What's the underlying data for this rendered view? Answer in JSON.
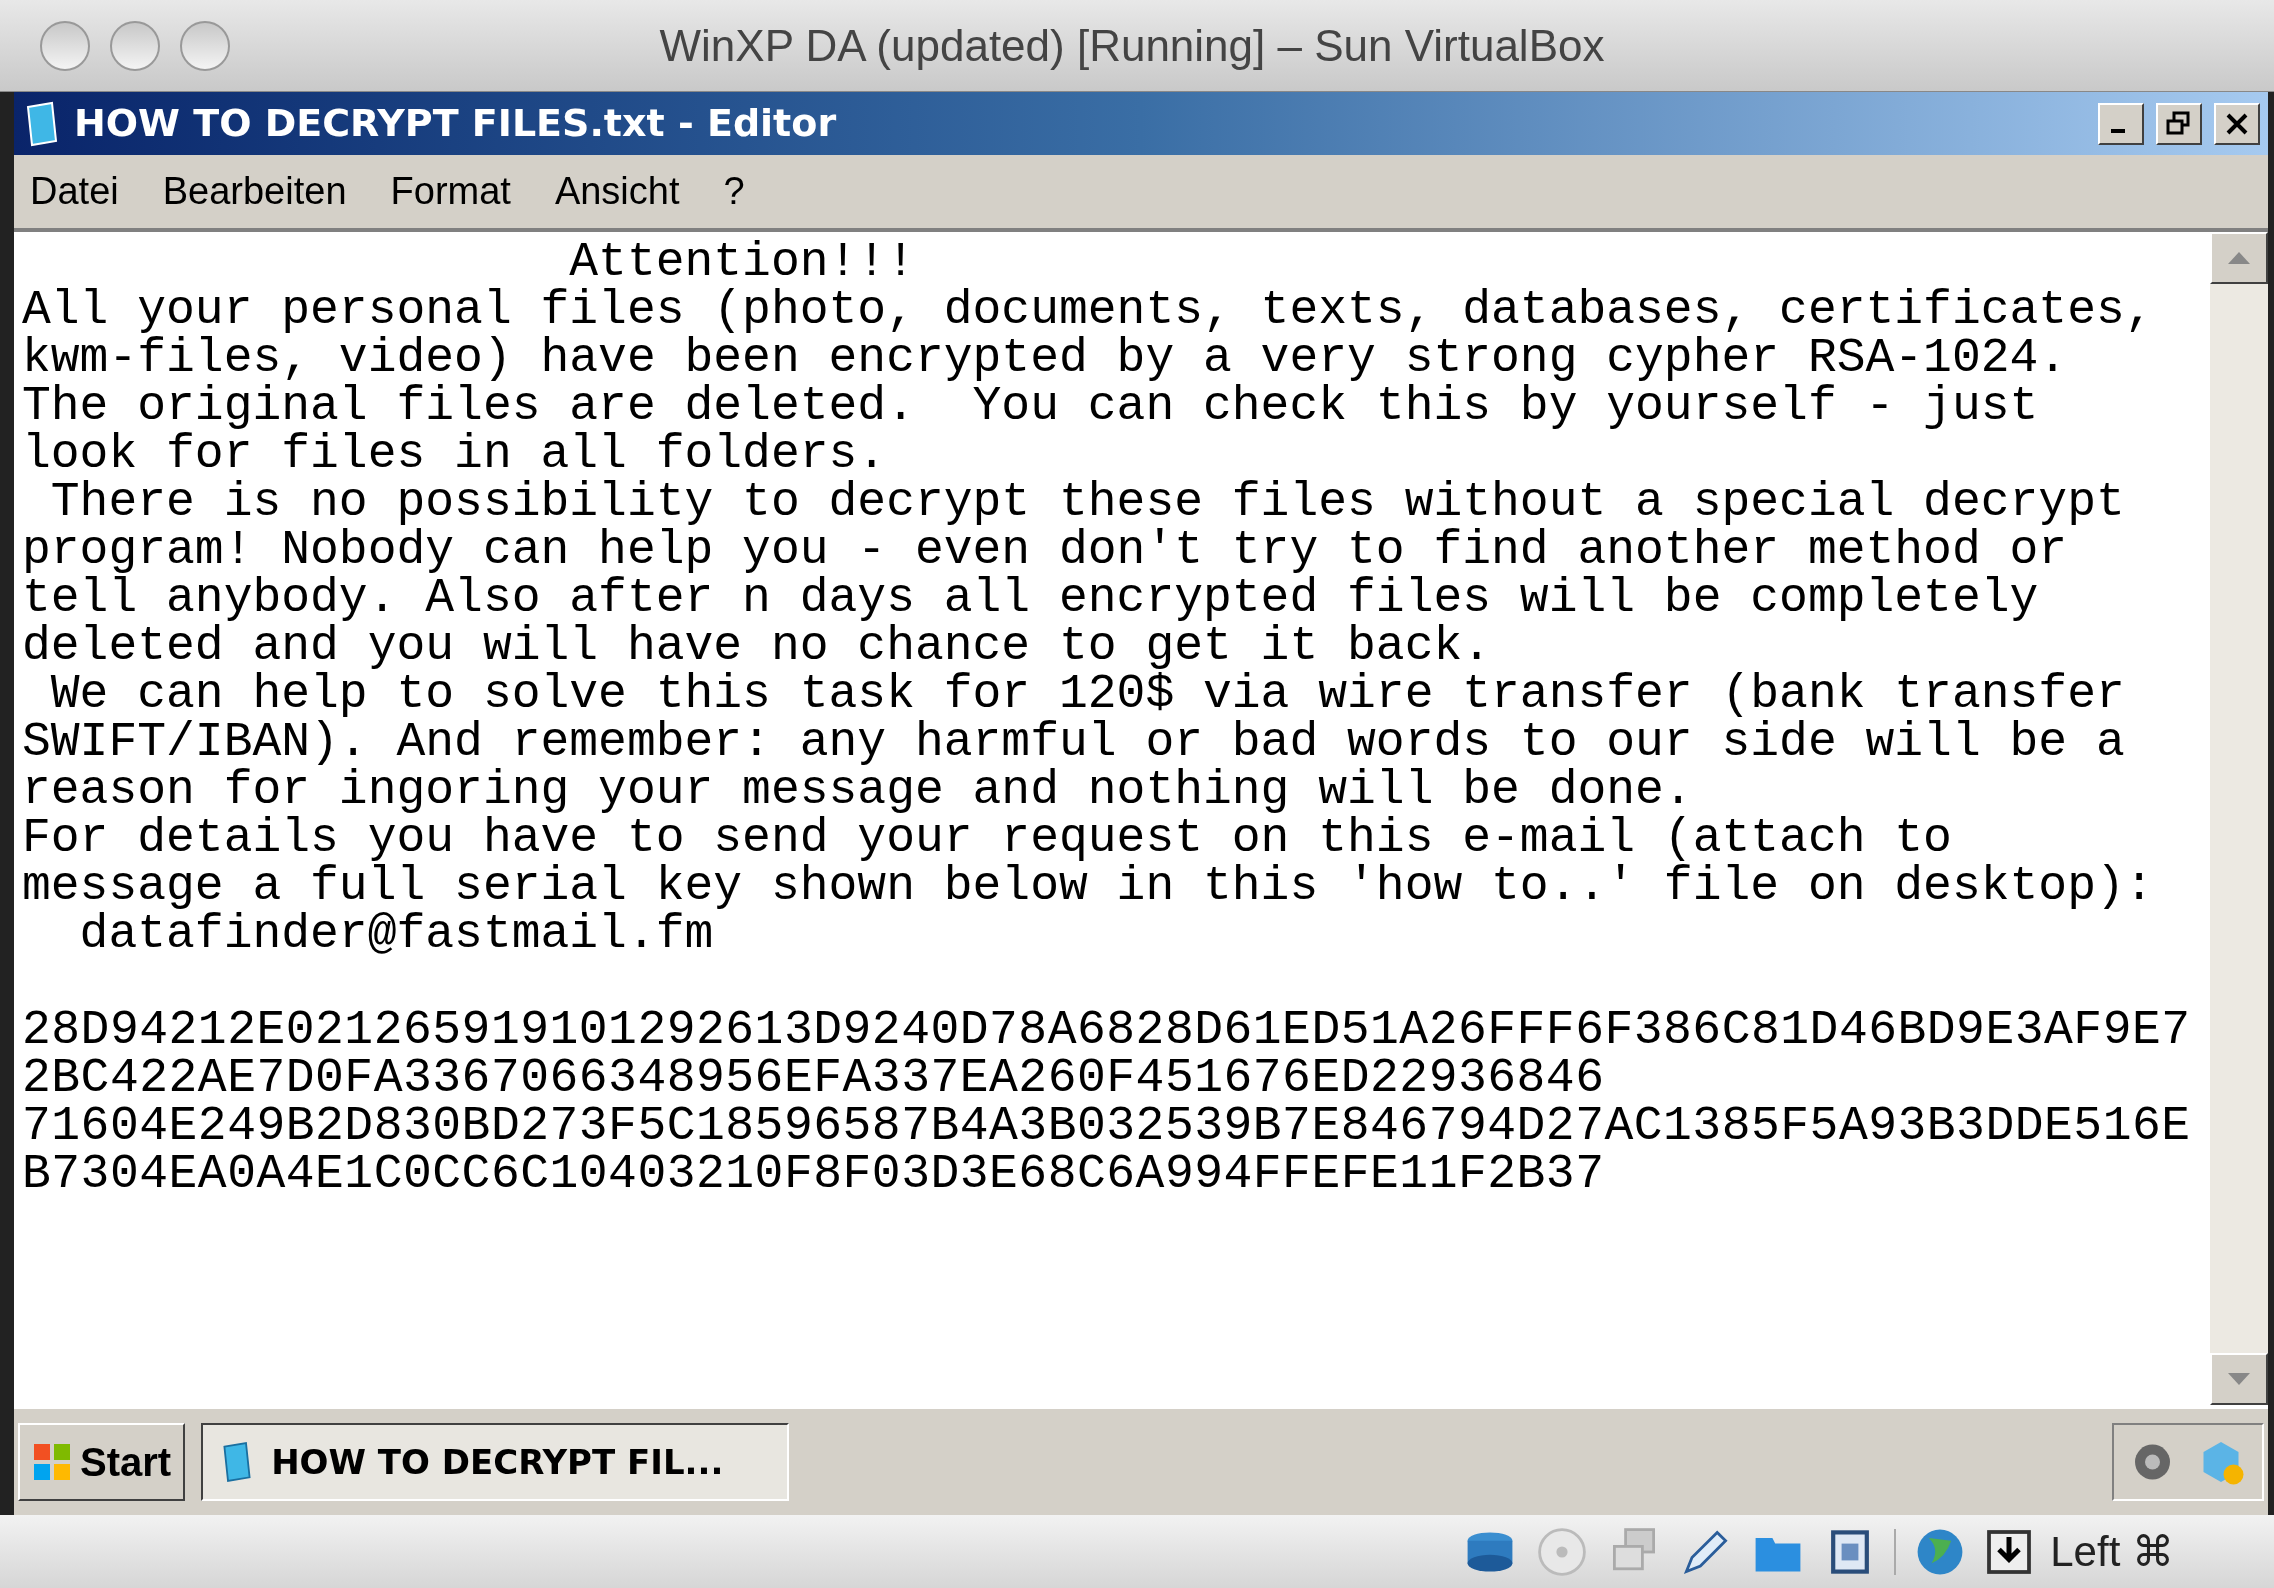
{
  "host_window": {
    "title": "WinXP DA (updated) [Running] – Sun VirtualBox"
  },
  "editor_window": {
    "title": "HOW TO DECRYPT FILES.txt - Editor"
  },
  "menu": [
    "Datei",
    "Bearbeiten",
    "Format",
    "Ansicht",
    "?"
  ],
  "document": {
    "lines": [
      "                   Attention!!!",
      "All your personal files (photo, documents, texts, databases, certificates,",
      "kwm-files, video) have been encrypted by a very strong cypher RSA-1024.",
      "The original files are deleted.  You can check this by yourself - just",
      "look for files in all folders.",
      " There is no possibility to decrypt these files without a special decrypt",
      "program! Nobody can help you - even don't try to find another method or",
      "tell anybody. Also after n days all encrypted files will be completely",
      "deleted and you will have no chance to get it back.",
      " We can help to solve this task for 120$ via wire transfer (bank transfer",
      "SWIFT/IBAN). And remember: any harmful or bad words to our side will be a",
      "reason for ingoring your message and nothing will be done.",
      "For details you have to send your request on this e-mail (attach to",
      "message a full serial key shown below in this 'how to..' file on desktop):",
      "  datafinder@fastmail.fm"
    ],
    "serial_key": [
      "28D94212E021265919101292613D9240D78A6828D61ED51A26FFF6F386C81D46BD9E3AF9E7",
      "2BC422AE7D0FA3367066348956EFA337EA260F451676ED22936846",
      "71604E249B2D830BD273F5C18596587B4A3B032539B7E846794D27AC1385F5A93B3DDE516E",
      "B7304EA0A4E1C0CC6C10403210F8F03D3E68C6A994FFEFE11F2B37"
    ]
  },
  "taskbar": {
    "start": "Start",
    "tasks": [
      {
        "label": "HOW TO DECRYPT FIL...",
        "selected": true
      }
    ]
  },
  "status_bar": {
    "host_key": "Left ⌘"
  }
}
